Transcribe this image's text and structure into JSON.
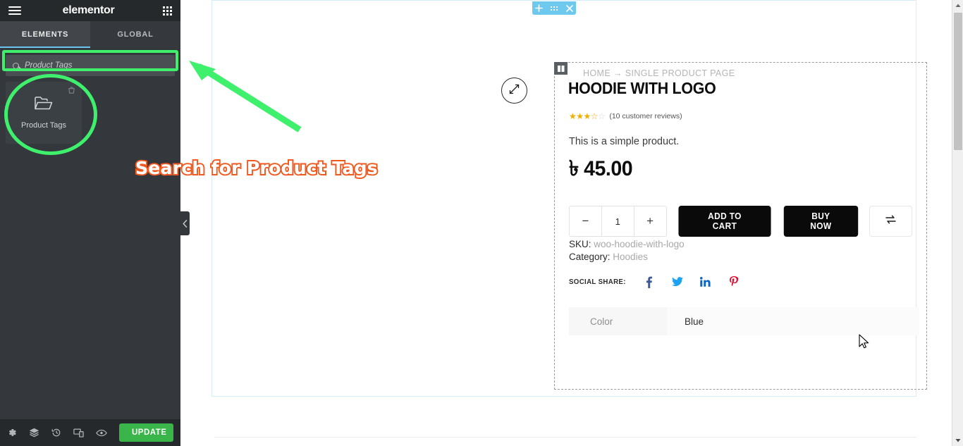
{
  "panel": {
    "logo": "elementor",
    "menu_icon": "hamburger-icon",
    "apps_icon": "grid-apps-icon",
    "tabs": [
      {
        "label": "ELEMENTS",
        "active": true
      },
      {
        "label": "GLOBAL",
        "active": false
      }
    ],
    "search": {
      "placeholder": "Product Tags",
      "value": "",
      "icon": "search-icon"
    },
    "widgets": [
      {
        "label": "Product Tags",
        "icon": "folder-icon",
        "badge": "pro-cart-badge"
      }
    ],
    "footer": {
      "settings_icon": "gear-icon",
      "navigator_icon": "layers-icon",
      "history_icon": "history-clock-icon",
      "responsive_icon": "responsive-devices-icon",
      "preview_icon": "eye-icon",
      "update_label": "UPDATE",
      "update_caret_icon": "chevron-up-icon"
    },
    "collapse_icon": "chevron-left-icon"
  },
  "canvas": {
    "section_handle": {
      "add_icon": "plus-icon",
      "drag_icon": "dots-grid-icon",
      "close_icon": "close-x-icon",
      "color": "#6ec9ef"
    },
    "zoom_button_icon": "expand-diagonal-icon",
    "widget_handle_icon": "columns-handle-icon",
    "product": {
      "breadcrumb": "HOME → SINGLE PRODUCT PAGE",
      "title": "HOODIE WITH LOGO",
      "rating_value": 3.5,
      "rating_max": 5,
      "reviews_text": "(10 customer reviews)",
      "short_description": "This is a simple product.",
      "currency_symbol": "৳",
      "price": "45.00",
      "quantity": {
        "decrement": "−",
        "value": "1",
        "increment": "+"
      },
      "add_to_cart_label": "ADD TO CART",
      "buy_now_label": "BUY NOW",
      "compare_icon": "compare-arrows-icon",
      "sku_label": "SKU:",
      "sku_value": "woo-hoodie-with-logo",
      "category_label": "Category:",
      "category_value": "Hoodies",
      "social_share_label": "SOCIAL SHARE:",
      "social_icons": [
        {
          "name": "facebook-icon",
          "glyph": "f",
          "color": "#3b5998"
        },
        {
          "name": "twitter-icon",
          "glyph": "ᵗ",
          "color": "#1da1f2"
        },
        {
          "name": "linkedin-icon",
          "glyph": "in",
          "color": "#0a66c2"
        },
        {
          "name": "pinterest-icon",
          "glyph": "Ԁ",
          "color": "#e60023"
        }
      ],
      "attributes": {
        "header": "Color",
        "value": "Blue"
      }
    }
  },
  "annotations": {
    "callout_text": "Search for Product Tags",
    "highlight_color": "#3ff06c",
    "text_outline_color": "#f2591f",
    "arrow_icon": "green-arrow-up-left"
  },
  "scrollbar": {
    "up_icon": "scroll-up-arrow",
    "down_icon": "scroll-down-arrow"
  },
  "cursor": {
    "icon": "mouse-pointer"
  }
}
